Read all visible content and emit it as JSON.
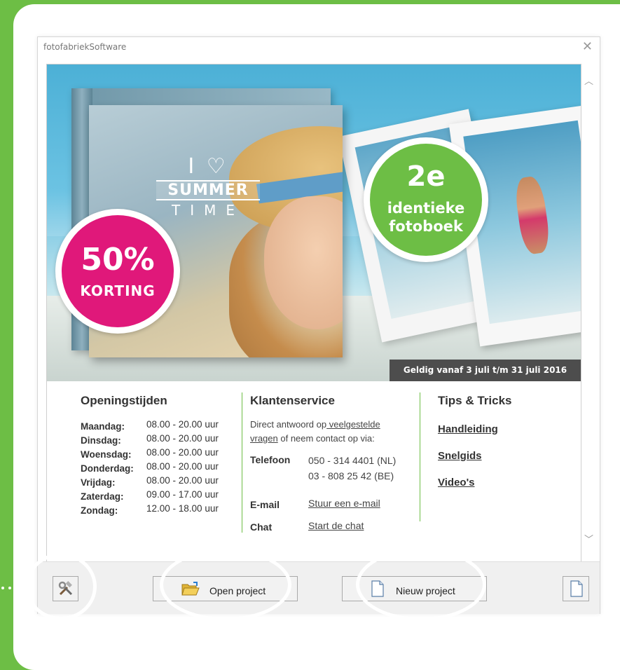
{
  "window": {
    "title": "fotofabriekSoftware"
  },
  "banner": {
    "summer_i": "I ♡",
    "summer_word": "SUMMER",
    "summer_time": "TIME",
    "discount_big": "50%",
    "discount_small": "KORTING",
    "offer_big": "2e",
    "offer_line1": "identieke",
    "offer_line2": "fotoboek",
    "validity": "Geldig vanaf 3 juli t/m 31 juli 2016"
  },
  "opening_hours": {
    "title": "Openingstijden",
    "rows": [
      {
        "day": "Maandag:",
        "hours": "08.00 - 20.00 uur"
      },
      {
        "day": "Dinsdag:",
        "hours": "08.00 - 20.00 uur"
      },
      {
        "day": "Woensdag:",
        "hours": "08.00 - 20.00 uur"
      },
      {
        "day": "Donderdag:",
        "hours": "08.00 - 20.00 uur"
      },
      {
        "day": "Vrijdag:",
        "hours": "08.00 - 20.00 uur"
      },
      {
        "day": "Zaterdag:",
        "hours": "09.00 - 17.00 uur"
      },
      {
        "day": "Zondag:",
        "hours": "12.00 - 18.00 uur"
      }
    ]
  },
  "service": {
    "title": "Klantenservice",
    "intro_pre": "Direct antwoord op",
    "intro_link_1": " veelgestelde",
    "intro_link_2": "vragen",
    "intro_post": " of neem contact op via:",
    "phone_label": "Telefoon",
    "phone_nl": "050 - 314 4401 (NL)",
    "phone_be": "03 - 808 25 42 (BE)",
    "email_label": "E-mail",
    "email_link": "Stuur een e-mail",
    "chat_label": "Chat",
    "chat_link": "Start de chat"
  },
  "tips": {
    "title": "Tips & Tricks",
    "links": [
      "Handleiding",
      "Snelgids",
      "Video's"
    ]
  },
  "toolbar": {
    "open_label": "Open project",
    "new_label": "Nieuw project"
  },
  "colors": {
    "brand_green": "#6dbe45",
    "badge_pink": "#e0187a"
  }
}
